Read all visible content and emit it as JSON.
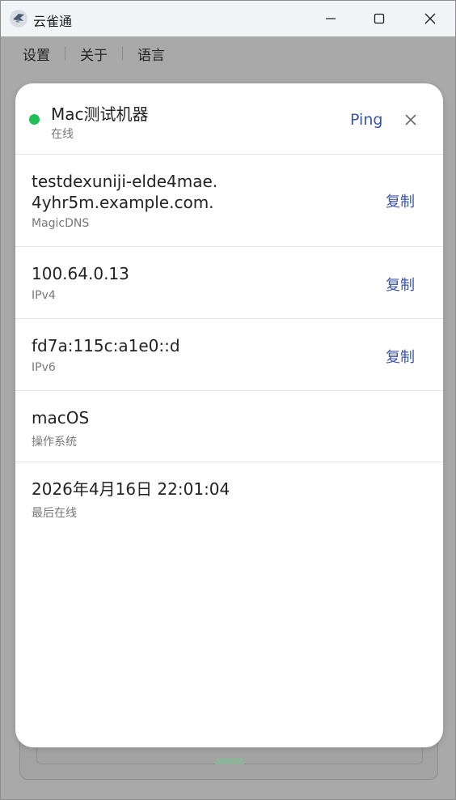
{
  "window": {
    "title": "云雀通"
  },
  "menu": {
    "items": [
      {
        "label": "设置"
      },
      {
        "label": "关于"
      },
      {
        "label": "语言"
      }
    ]
  },
  "dialog": {
    "device_name": "Mac测试机器",
    "status_text": "在线",
    "status_color": "#1fbf5a",
    "ping_label": "Ping",
    "accent_color": "#3a56a8",
    "rows": {
      "dns": {
        "value_line1": "testdexuniji-elde4mae.",
        "value_line2": "4yhr5m.example.com.",
        "label": "MagicDNS",
        "copy_label": "复制"
      },
      "ipv4": {
        "value": "100.64.0.13",
        "label": "IPv4",
        "copy_label": "复制"
      },
      "ipv6": {
        "value": "fd7a:115c:a1e0::d",
        "label": "IPv6",
        "copy_label": "复制"
      },
      "os": {
        "value": "macOS",
        "label": "操作系统"
      },
      "last_seen": {
        "value": "2026年4月16日 22:01:04",
        "label": "最后在线"
      }
    }
  }
}
